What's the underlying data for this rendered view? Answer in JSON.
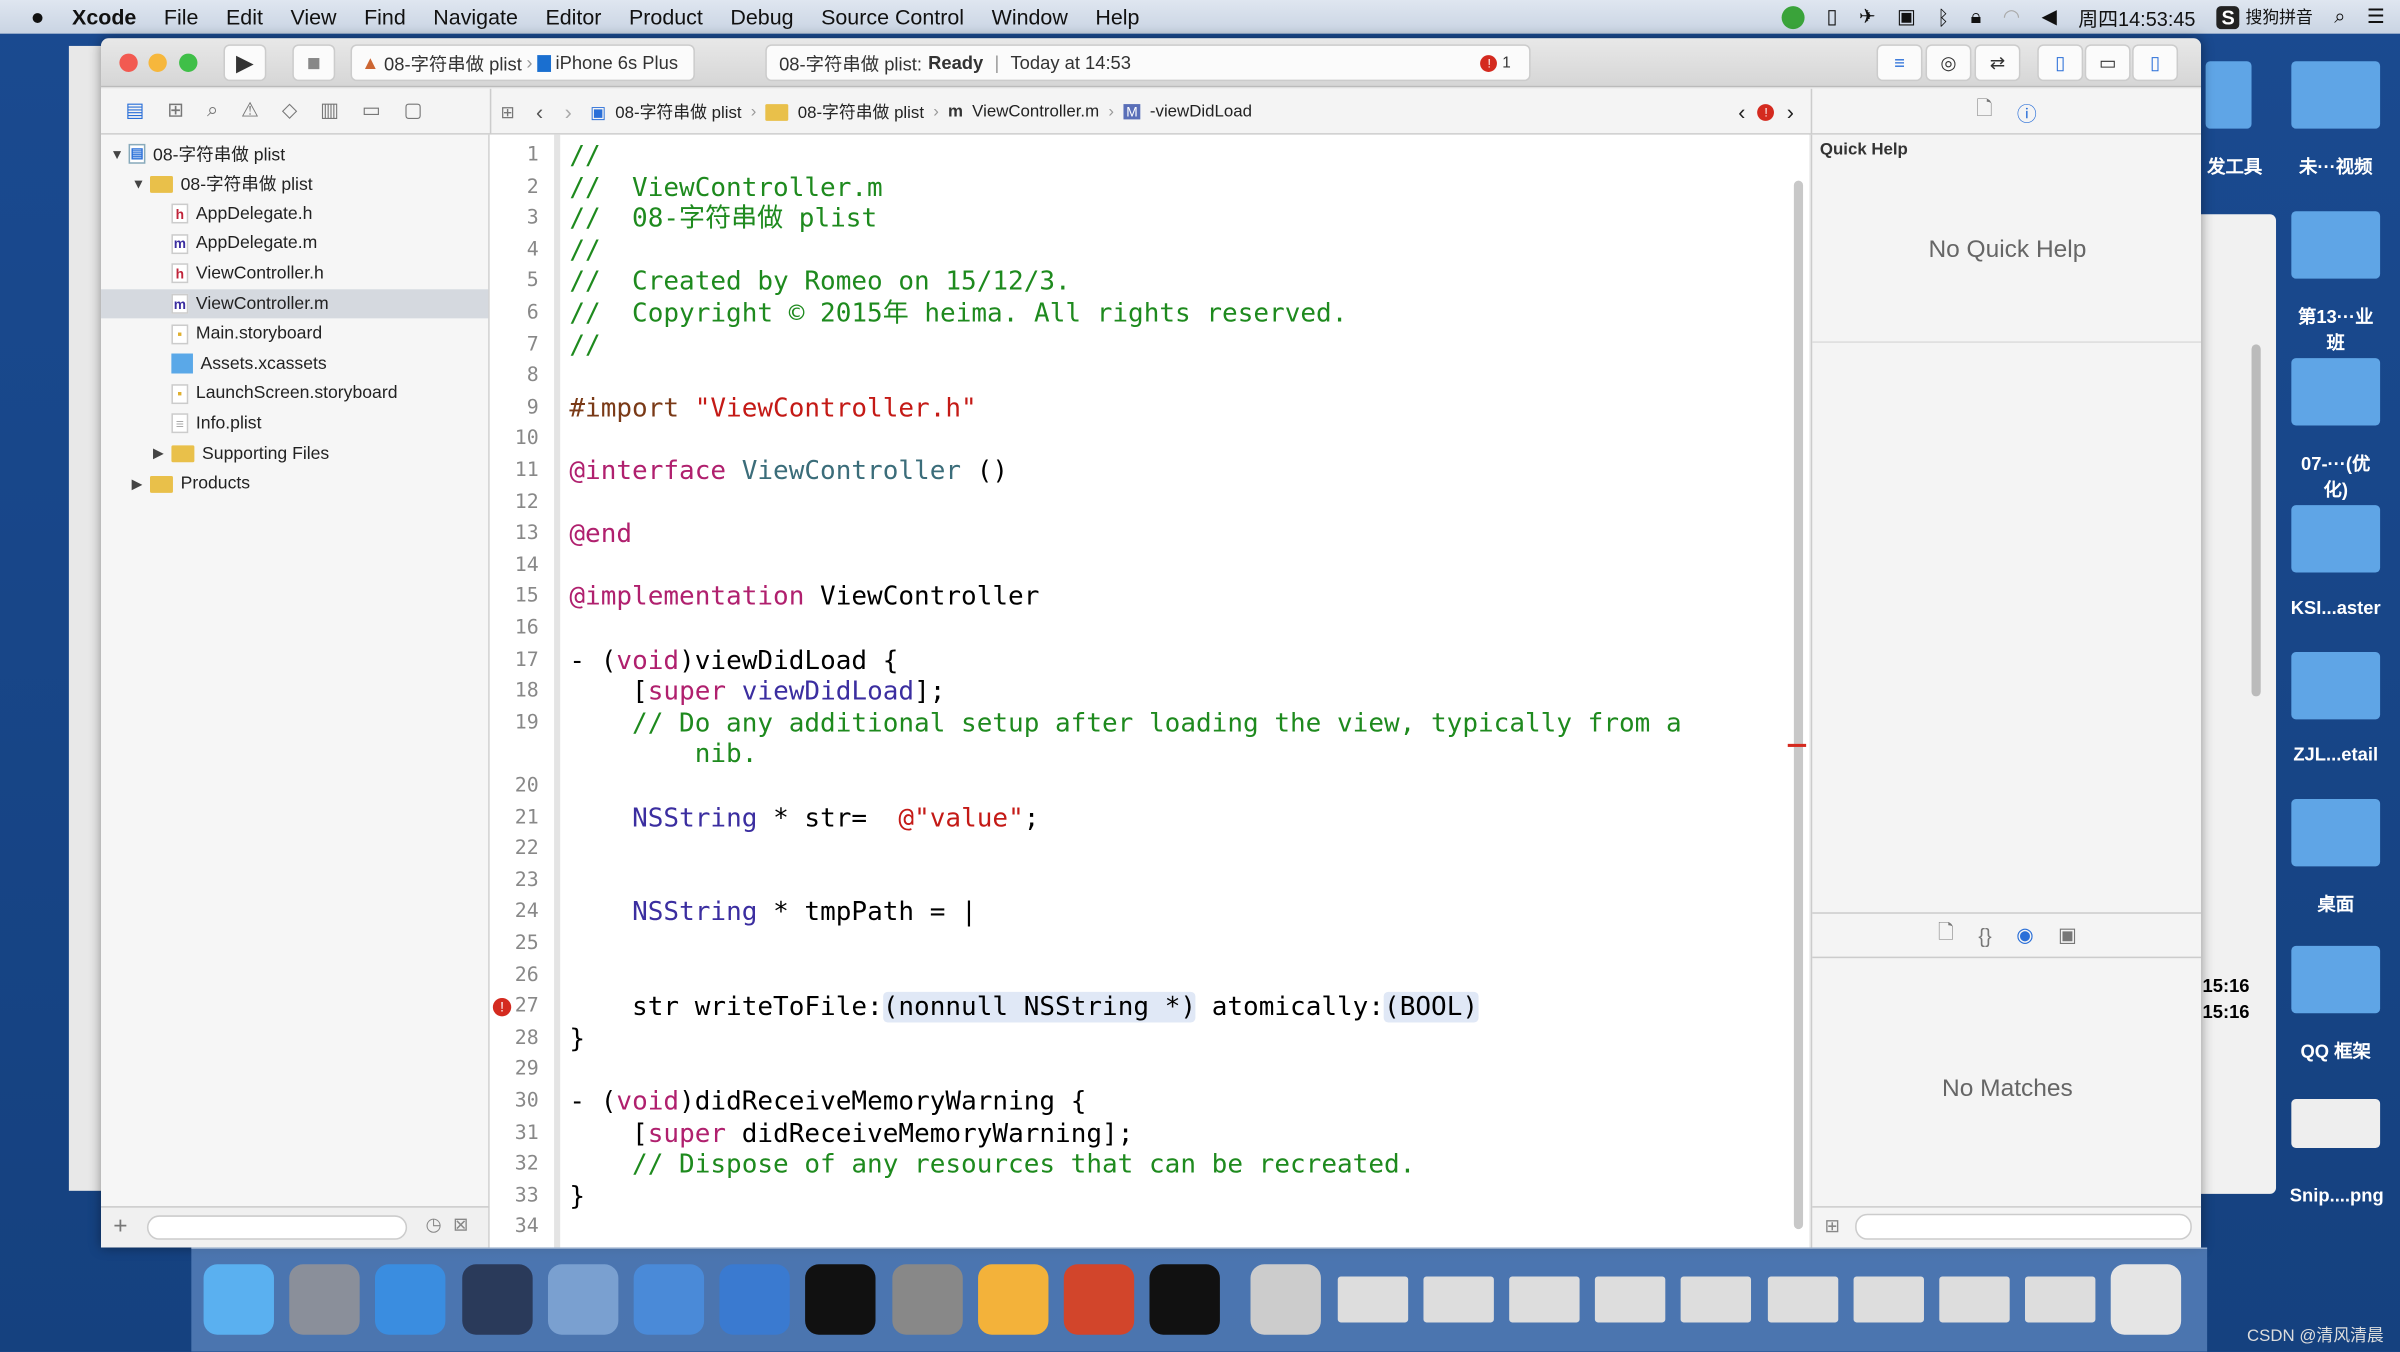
{
  "menubar": {
    "app": "Xcode",
    "items": [
      "File",
      "Edit",
      "View",
      "Find",
      "Navigate",
      "Editor",
      "Product",
      "Debug",
      "Source Control",
      "Window",
      "Help"
    ],
    "clock": "周四14:53:45",
    "ime": "搜狗拼音"
  },
  "toolbar": {
    "scheme": "08-字符串做 plist",
    "device": "iPhone 6s Plus",
    "status_project": "08-字符串做 plist:",
    "status_state": "Ready",
    "status_time": "Today at 14:53",
    "error_count": "1"
  },
  "jumpbar": {
    "crumbs": [
      "08-字符串做 plist",
      "08-字符串做 plist",
      "ViewController.m",
      "-viewDidLoad"
    ]
  },
  "navigator": {
    "items": [
      {
        "label": "08-字符串做 plist",
        "kind": "project",
        "depth": 0,
        "open": true
      },
      {
        "label": "08-字符串做 plist",
        "kind": "folder",
        "depth": 1,
        "open": true
      },
      {
        "label": "AppDelegate.h",
        "kind": "h",
        "depth": 2
      },
      {
        "label": "AppDelegate.m",
        "kind": "m",
        "depth": 2
      },
      {
        "label": "ViewController.h",
        "kind": "h",
        "depth": 2
      },
      {
        "label": "ViewController.m",
        "kind": "m",
        "depth": 2,
        "selected": true
      },
      {
        "label": "Main.storyboard",
        "kind": "sb",
        "depth": 2
      },
      {
        "label": "Assets.xcassets",
        "kind": "assets",
        "depth": 2
      },
      {
        "label": "LaunchScreen.storyboard",
        "kind": "sb",
        "depth": 2
      },
      {
        "label": "Info.plist",
        "kind": "plist",
        "depth": 2
      },
      {
        "label": "Supporting Files",
        "kind": "folder",
        "depth": 2,
        "open": false
      },
      {
        "label": "Products",
        "kind": "folder",
        "depth": 1,
        "open": false
      }
    ]
  },
  "editor": {
    "error_line": 27,
    "lines": [
      {
        "n": "1",
        "t": [
          [
            "//",
            "cm"
          ]
        ]
      },
      {
        "n": "2",
        "t": [
          [
            "//  ViewController.m",
            "cm"
          ]
        ]
      },
      {
        "n": "3",
        "t": [
          [
            "//  08-字符串做 plist",
            "cm"
          ]
        ]
      },
      {
        "n": "4",
        "t": [
          [
            "//",
            "cm"
          ]
        ]
      },
      {
        "n": "5",
        "t": [
          [
            "//  Created by Romeo on 15/12/3.",
            "cm"
          ]
        ]
      },
      {
        "n": "6",
        "t": [
          [
            "//  Copyright © 2015年 heima. All rights reserved.",
            "cm"
          ]
        ]
      },
      {
        "n": "7",
        "t": [
          [
            "//",
            "cm"
          ]
        ]
      },
      {
        "n": "8",
        "t": []
      },
      {
        "n": "9",
        "t": [
          [
            "#import ",
            "pp"
          ],
          [
            "\"ViewController.h\"",
            "st"
          ]
        ]
      },
      {
        "n": "10",
        "t": []
      },
      {
        "n": "11",
        "t": [
          [
            "@interface ",
            "kw"
          ],
          [
            "ViewController",
            "cls"
          ],
          [
            " ()",
            ""
          ]
        ]
      },
      {
        "n": "12",
        "t": []
      },
      {
        "n": "13",
        "t": [
          [
            "@end",
            "kw"
          ]
        ]
      },
      {
        "n": "14",
        "t": []
      },
      {
        "n": "15",
        "t": [
          [
            "@implementation ",
            "kw"
          ],
          [
            "ViewController",
            ""
          ]
        ]
      },
      {
        "n": "16",
        "t": []
      },
      {
        "n": "17",
        "t": [
          [
            "- (",
            ""
          ],
          [
            "void",
            "kw"
          ],
          [
            ")viewDidLoad {",
            ""
          ]
        ]
      },
      {
        "n": "18",
        "t": [
          [
            "    [",
            ""
          ],
          [
            "super",
            "kw"
          ],
          [
            " viewDidLoad",
            "ty"
          ],
          [
            "];",
            ""
          ]
        ]
      },
      {
        "n": "19",
        "t": [
          [
            "    // Do any additional setup after loading the view, typically from a",
            "cm"
          ]
        ]
      },
      {
        "n": "",
        "t": [
          [
            "        nib.",
            "cm"
          ]
        ]
      },
      {
        "n": "20",
        "t": []
      },
      {
        "n": "21",
        "t": [
          [
            "    ",
            ""
          ],
          [
            "NSString",
            "ty"
          ],
          [
            " * str=  ",
            ""
          ],
          [
            "@\"value\"",
            "st"
          ],
          [
            ";",
            ""
          ]
        ]
      },
      {
        "n": "22",
        "t": []
      },
      {
        "n": "23",
        "t": []
      },
      {
        "n": "24",
        "t": [
          [
            "    ",
            ""
          ],
          [
            "NSString",
            "ty"
          ],
          [
            " * tmpPath = |",
            ""
          ]
        ]
      },
      {
        "n": "25",
        "t": []
      },
      {
        "n": "26",
        "t": []
      },
      {
        "n": "27",
        "t": [
          [
            "    str writeToFile:",
            ""
          ],
          [
            "(nonnull NSString *)",
            "ph"
          ],
          [
            " atomically:",
            ""
          ],
          [
            "(BOOL)",
            "ph"
          ]
        ]
      },
      {
        "n": "28",
        "t": [
          [
            "}",
            ""
          ]
        ]
      },
      {
        "n": "29",
        "t": []
      },
      {
        "n": "30",
        "t": [
          [
            "- (",
            ""
          ],
          [
            "void",
            "kw"
          ],
          [
            ")didReceiveMemoryWarning {",
            ""
          ]
        ]
      },
      {
        "n": "31",
        "t": [
          [
            "    [",
            ""
          ],
          [
            "super",
            "kw"
          ],
          [
            " didReceiveMemoryWarning];",
            ""
          ]
        ]
      },
      {
        "n": "32",
        "t": [
          [
            "    // Dispose of any resources that can be recreated.",
            "cm"
          ]
        ]
      },
      {
        "n": "33",
        "t": [
          [
            "}",
            ""
          ]
        ]
      },
      {
        "n": "34",
        "t": []
      }
    ]
  },
  "inspector": {
    "title": "Quick Help",
    "empty": "No Quick Help",
    "library_empty": "No Matches"
  },
  "desktop": {
    "items": [
      "发工具",
      "未···视频",
      "第13···业班",
      "07-···(优化)",
      "KSI...aster",
      "ZJL...etail",
      "桌面",
      "QQ 框架",
      "Snip....png"
    ],
    "behind": [
      "15:16",
      "15:16"
    ],
    "watermark": "CSDN @清风清晨"
  },
  "colors": {
    "error": "#d42a1f",
    "accent": "#2a6fd8",
    "desktop": "#1a4a90"
  }
}
